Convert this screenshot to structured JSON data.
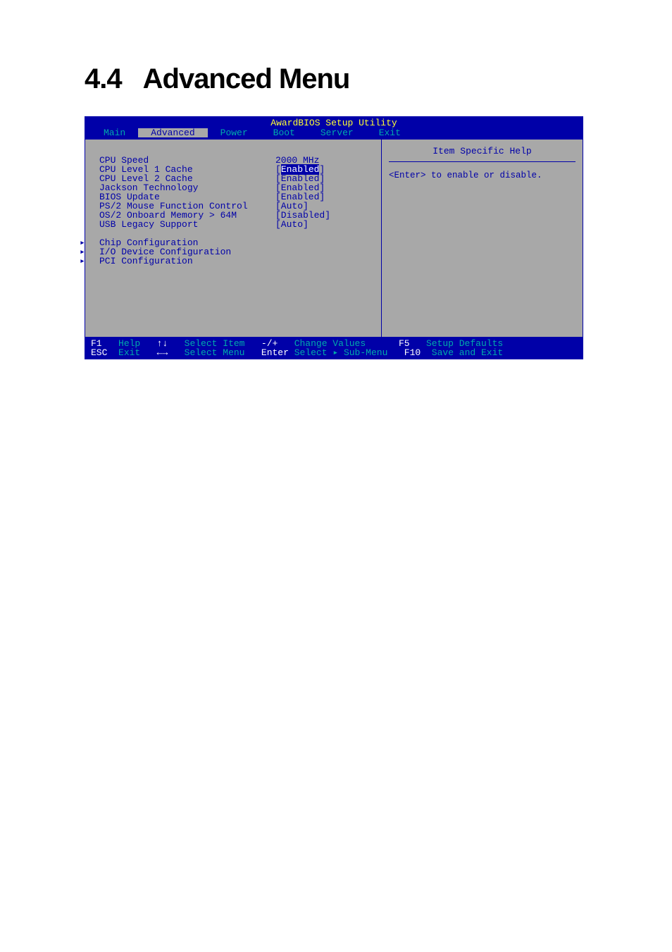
{
  "heading": {
    "number": "4.4",
    "title": "Advanced Menu"
  },
  "bios": {
    "title": "AwardBIOS Setup Utility",
    "tabs": [
      "Main",
      "Advanced",
      "Power",
      "Boot",
      "Server",
      "Exit"
    ],
    "active_tab": "Advanced",
    "settings": [
      {
        "label": "CPU Speed",
        "value": "2000 MHz",
        "selected": false
      },
      {
        "label": "CPU Level 1 Cache",
        "value": "[Enabled]",
        "selected": true
      },
      {
        "label": "CPU Level 2 Cache",
        "value": "[Enabled]",
        "selected": false
      },
      {
        "label": "Jackson Technology",
        "value": "[Enabled]",
        "selected": false
      },
      {
        "label": "BIOS Update",
        "value": "[Enabled]",
        "selected": false
      },
      {
        "label": "PS/2 Mouse Function Control",
        "value": "[Auto]",
        "selected": false
      },
      {
        "label": "OS/2 Onboard Memory > 64M",
        "value": "[Disabled]",
        "selected": false
      },
      {
        "label": "USB Legacy Support",
        "value": "[Auto]",
        "selected": false
      }
    ],
    "submenus": [
      "Chip Configuration",
      "I/O Device Configuration",
      "PCI Configuration"
    ],
    "help": {
      "title": "Item Specific Help",
      "text": "<Enter> to enable or disable."
    },
    "footer": {
      "r1": {
        "k1": "F1",
        "a1": "Help",
        "k2": "↑↓",
        "a2": "Select Item",
        "k3": "-/+",
        "a3": "Change Values",
        "k4": "F5",
        "a4": "Setup Defaults"
      },
      "r2": {
        "k1": "ESC",
        "a1": "Exit",
        "k2": "←→",
        "a2": "Select Menu",
        "k3": "Enter",
        "a3": "Select ▸ Sub-Menu",
        "k4": "F10",
        "a4": "Save and Exit"
      }
    }
  }
}
